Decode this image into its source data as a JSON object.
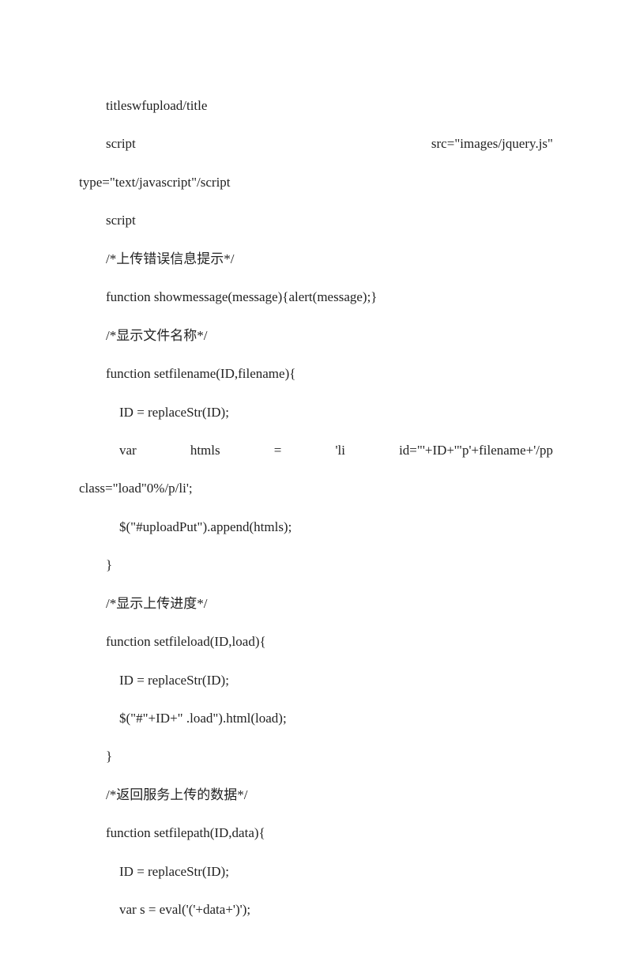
{
  "lines": {
    "l1": "titleswfupload/title",
    "l2a": "script",
    "l2b": "src=\"images/jquery.js\"",
    "l3": "type=\"text/javascript\"/script",
    "l4": "script",
    "l5": "/*上传错误信息提示*/",
    "l6": "function showmessage(message){alert(message);}",
    "l7": "/*显示文件名称*/",
    "l8": "function setfilename(ID,filename){",
    "l9": "ID = replaceStr(ID);",
    "l10a": "var",
    "l10b": "htmls",
    "l10c": "=",
    "l10d": "'li",
    "l10e": "id=\"'+ID+'\"p'+filename+'/pp",
    "l11": "class=\"load\"0%/p/li';",
    "l12": "$(\"#uploadPut\").append(htmls);",
    "l13": "}",
    "l14": "/*显示上传进度*/",
    "l15": "function setfileload(ID,load){",
    "l16": "ID = replaceStr(ID);",
    "l17": "$(\"#\"+ID+\" .load\").html(load);",
    "l18": "}",
    "l19": "/*返回服务上传的数据*/",
    "l20": "function setfilepath(ID,data){",
    "l21": "ID = replaceStr(ID);",
    "l22": "var s = eval('('+data+')');"
  }
}
